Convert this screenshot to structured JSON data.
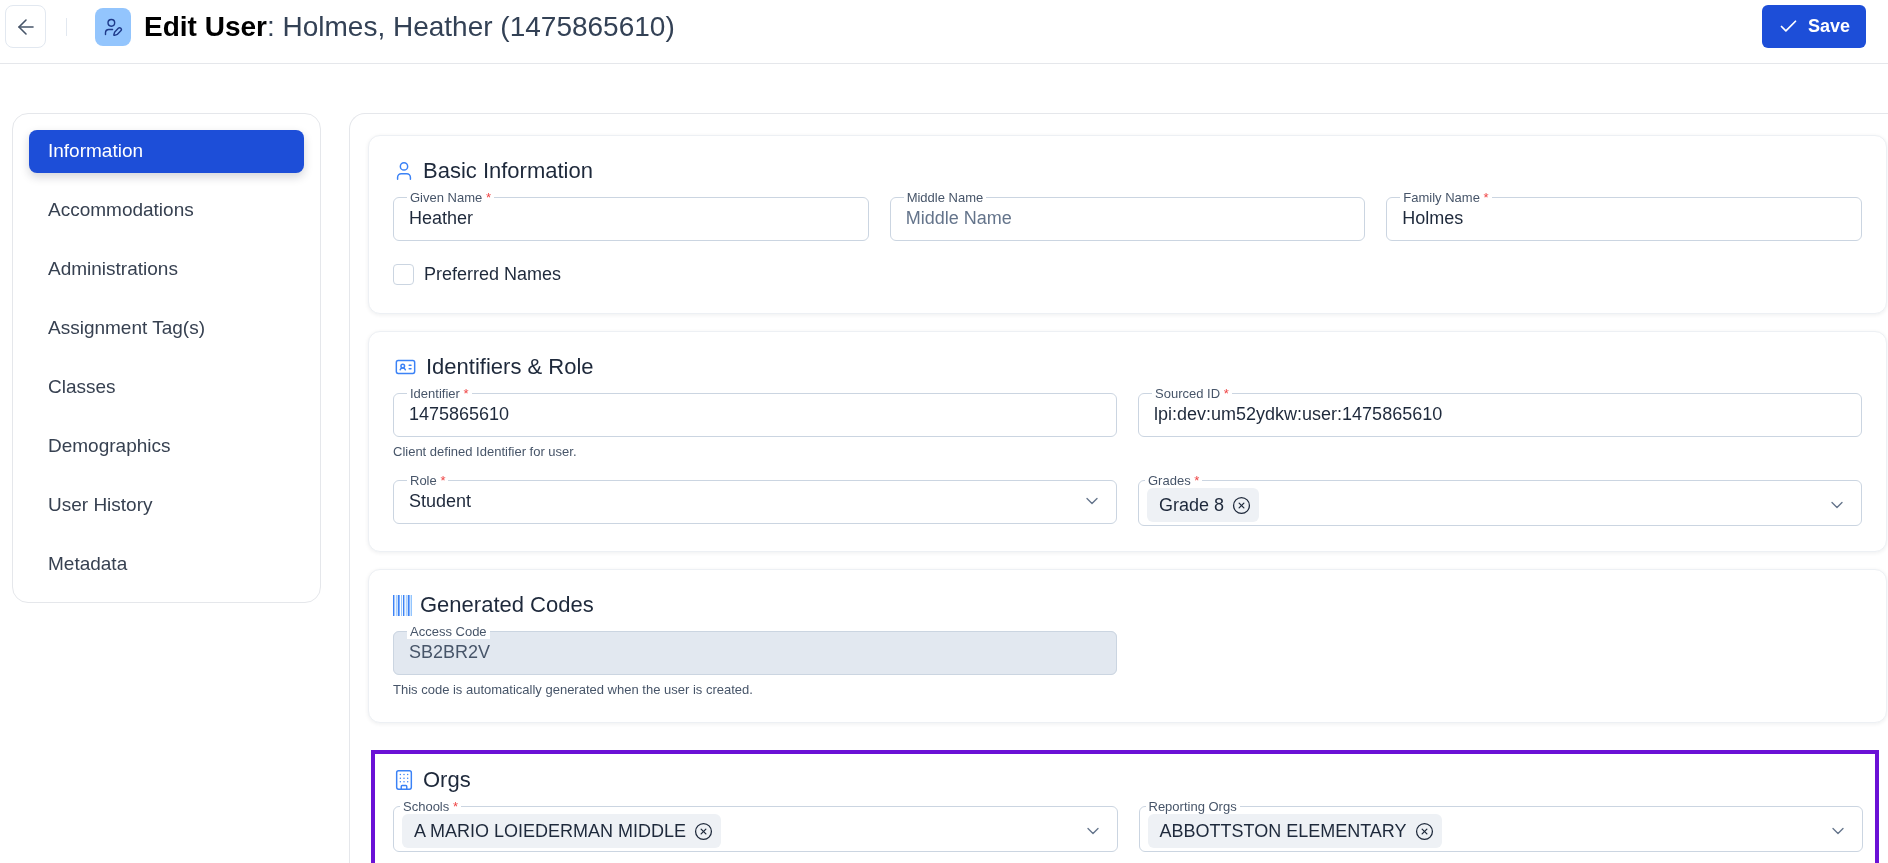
{
  "header": {
    "title": "**Edit User**: Holmes, Heather (1475865610)",
    "save_label": "Save"
  },
  "sidebar": {
    "items": [
      {
        "label": "Information",
        "selected": true
      },
      {
        "label": "Accommodations",
        "selected": false
      },
      {
        "label": "Administrations",
        "selected": false
      },
      {
        "label": "Assignment Tag(s)",
        "selected": false
      },
      {
        "label": "Classes",
        "selected": false
      },
      {
        "label": "Demographics",
        "selected": false
      },
      {
        "label": "User History",
        "selected": false
      },
      {
        "label": "Metadata",
        "selected": false
      }
    ]
  },
  "sections": [
    {
      "kind": "basic",
      "title": "Basic Information",
      "highlighted": false,
      "rows": [
        [
          {
            "kind": "text",
            "label": "Given Name",
            "required_mark": "*",
            "value": "Heather",
            "disabled": false
          },
          {
            "kind": "text",
            "label": "Middle Name",
            "placeholder": "Middle Name",
            "disabled": false
          },
          {
            "kind": "text",
            "label": "Family Name",
            "required_mark": "*",
            "value": "Holmes",
            "disabled": false
          }
        ]
      ],
      "checkbox": {
        "label": "Preferred Names",
        "checked": false
      }
    },
    {
      "kind": "identifiers",
      "title": "Identifiers & Role",
      "highlighted": false,
      "rows": [
        [
          {
            "kind": "text",
            "label": "Identifier",
            "required_mark": "*",
            "value": "1475865610",
            "disabled": false,
            "helper": "Client defined Identifier for user."
          },
          {
            "kind": "text",
            "label": "Sourced ID",
            "required_mark": "*",
            "value": "lpi:dev:um52ydkw:user:1475865610",
            "disabled": false
          }
        ],
        [
          {
            "kind": "select",
            "label": "Role",
            "required_mark": "*",
            "value": "Student",
            "disabled": false
          },
          {
            "kind": "multiselect",
            "label": "Grades",
            "required_mark": "*",
            "chips": [
              "Grade 8"
            ],
            "disabled": false
          }
        ]
      ]
    },
    {
      "kind": "codes",
      "title": "Generated Codes",
      "highlighted": false,
      "rows": [
        [
          {
            "kind": "text",
            "label": "Access Code",
            "value": "SB2BR2V",
            "disabled": true,
            "helper": "This code is automatically generated when the user is created."
          }
        ]
      ]
    },
    {
      "kind": "orgs",
      "title": "Orgs",
      "highlighted": true,
      "rows": [
        [
          {
            "kind": "multiselect",
            "label": "Schools",
            "required_mark": "*",
            "chips": [
              "A MARIO LOIEDERMAN MIDDLE"
            ],
            "disabled": false
          },
          {
            "kind": "multiselect",
            "label": "Reporting Orgs",
            "chips": [
              "ABBOTTSTON ELEMENTARY"
            ],
            "disabled": false
          }
        ]
      ]
    }
  ]
}
